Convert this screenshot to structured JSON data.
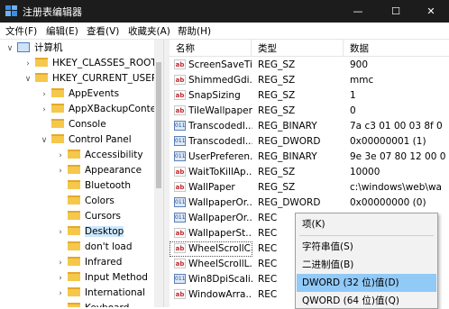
{
  "window": {
    "title": "注册表编辑器",
    "minimize_glyph": "—",
    "maximize_glyph": "☐",
    "close_glyph": "✕",
    "icon": "registry-icon"
  },
  "menu": [
    "文件(F)",
    "编辑(E)",
    "查看(V)",
    "收藏夹(A)",
    "帮助(H)"
  ],
  "tree": [
    {
      "label": "计算机",
      "arrow": "∨",
      "icon": "computer-icon"
    },
    {
      "label": "HKEY_CLASSES_ROOT",
      "arrow": "›",
      "icon": "folder-icon"
    },
    {
      "label": "HKEY_CURRENT_USER",
      "arrow": "∨",
      "icon": "folder-icon"
    },
    {
      "label": "AppEvents",
      "arrow": "›",
      "icon": "folder-icon"
    },
    {
      "label": "AppXBackupConter",
      "arrow": "›",
      "icon": "folder-icon"
    },
    {
      "label": "Console",
      "arrow": "",
      "icon": "folder-icon"
    },
    {
      "label": "Control Panel",
      "arrow": "∨",
      "icon": "folder-icon"
    },
    {
      "label": "Accessibility",
      "arrow": "›",
      "icon": "folder-icon"
    },
    {
      "label": "Appearance",
      "arrow": "›",
      "icon": "folder-icon"
    },
    {
      "label": "Bluetooth",
      "arrow": "",
      "icon": "folder-icon"
    },
    {
      "label": "Colors",
      "arrow": "",
      "icon": "folder-icon"
    },
    {
      "label": "Cursors",
      "arrow": "",
      "icon": "folder-icon"
    },
    {
      "label": "Desktop",
      "arrow": "›",
      "icon": "folder-icon",
      "selected": true
    },
    {
      "label": "don't load",
      "arrow": "",
      "icon": "folder-icon"
    },
    {
      "label": "Infrared",
      "arrow": "›",
      "icon": "folder-icon"
    },
    {
      "label": "Input Method",
      "arrow": "›",
      "icon": "folder-icon"
    },
    {
      "label": "International",
      "arrow": "›",
      "icon": "folder-icon"
    },
    {
      "label": "Keyboard",
      "arrow": "",
      "icon": "folder-icon"
    }
  ],
  "columns": {
    "name": "名称",
    "type": "类型",
    "data": "数据"
  },
  "values": [
    {
      "name": "ScreenSaveTi...",
      "type": "REG_SZ",
      "data": "900",
      "kind": "string"
    },
    {
      "name": "ShimmedGdi...",
      "type": "REG_SZ",
      "data": "mmc",
      "kind": "string"
    },
    {
      "name": "SnapSizing",
      "type": "REG_SZ",
      "data": "1",
      "kind": "string"
    },
    {
      "name": "TileWallpaper",
      "type": "REG_SZ",
      "data": "0",
      "kind": "string"
    },
    {
      "name": "TranscodedI...",
      "type": "REG_BINARY",
      "data": "7a c3 01 00 03 8f 0",
      "kind": "binary"
    },
    {
      "name": "TranscodedI...",
      "type": "REG_DWORD",
      "data": "0x00000001 (1)",
      "kind": "binary"
    },
    {
      "name": "UserPreferen...",
      "type": "REG_BINARY",
      "data": "9e 3e 07 80 12 00 0",
      "kind": "binary"
    },
    {
      "name": "WaitToKillAp...",
      "type": "REG_SZ",
      "data": "10000",
      "kind": "string"
    },
    {
      "name": "WallPaper",
      "type": "REG_SZ",
      "data": "c:\\windows\\web\\wa",
      "kind": "string"
    },
    {
      "name": "WallpaperOr...",
      "type": "REG_DWORD",
      "data": "0x00000000 (0)",
      "kind": "binary"
    },
    {
      "name": "WallpaperOr...",
      "type": "REC",
      "data": "",
      "kind": "binary"
    },
    {
      "name": "WallpaperSt...",
      "type": "REC",
      "data": "",
      "kind": "string"
    },
    {
      "name": "WheelScrollC...",
      "type": "REC",
      "data": "",
      "kind": "string",
      "focused": true
    },
    {
      "name": "WheelScrollL...",
      "type": "REC",
      "data": "",
      "kind": "string"
    },
    {
      "name": "Win8DpiScali...",
      "type": "REC",
      "data": "",
      "kind": "binary"
    },
    {
      "name": "WindowArra...",
      "type": "REC",
      "data": "",
      "kind": "string"
    }
  ],
  "context_menu": [
    {
      "label": "项(K)",
      "highlighted": false
    },
    {
      "separator": true
    },
    {
      "label": "字符串值(S)",
      "highlighted": false
    },
    {
      "label": "二进制值(B)",
      "highlighted": false
    },
    {
      "label": "DWORD (32 位)值(D)",
      "highlighted": true
    },
    {
      "label": "QWORD (64 位)值(Q)",
      "highlighted": false
    }
  ],
  "colors": {
    "titlebar": "#1c1c1c",
    "selection": "#cce8ff",
    "menu_highlight": "#91c9f7"
  }
}
